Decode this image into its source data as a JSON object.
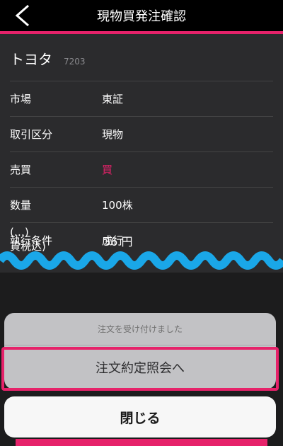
{
  "header": {
    "title": "現物買発注確認",
    "back_icon": "chevron-left-icon"
  },
  "stock": {
    "name": "トヨタ",
    "code": "7203"
  },
  "rows": [
    {
      "label": "市場",
      "value": "東証"
    },
    {
      "label": "取引区分",
      "value": "現物"
    },
    {
      "label": "売買",
      "value": "買"
    },
    {
      "label": "数量",
      "value": "100株"
    },
    {
      "label": "執行条件",
      "value": "成行"
    }
  ],
  "partial_row": {
    "label": "(…)\n貨税込)",
    "value": "36 円"
  },
  "sheet": {
    "message": "注文を受け付けました",
    "action_label": "注文約定照会へ"
  },
  "close_label": "閉じる",
  "colors": {
    "accent": "#e6226a",
    "wave": "#1aa7e8",
    "background": "#2b2b2d"
  }
}
